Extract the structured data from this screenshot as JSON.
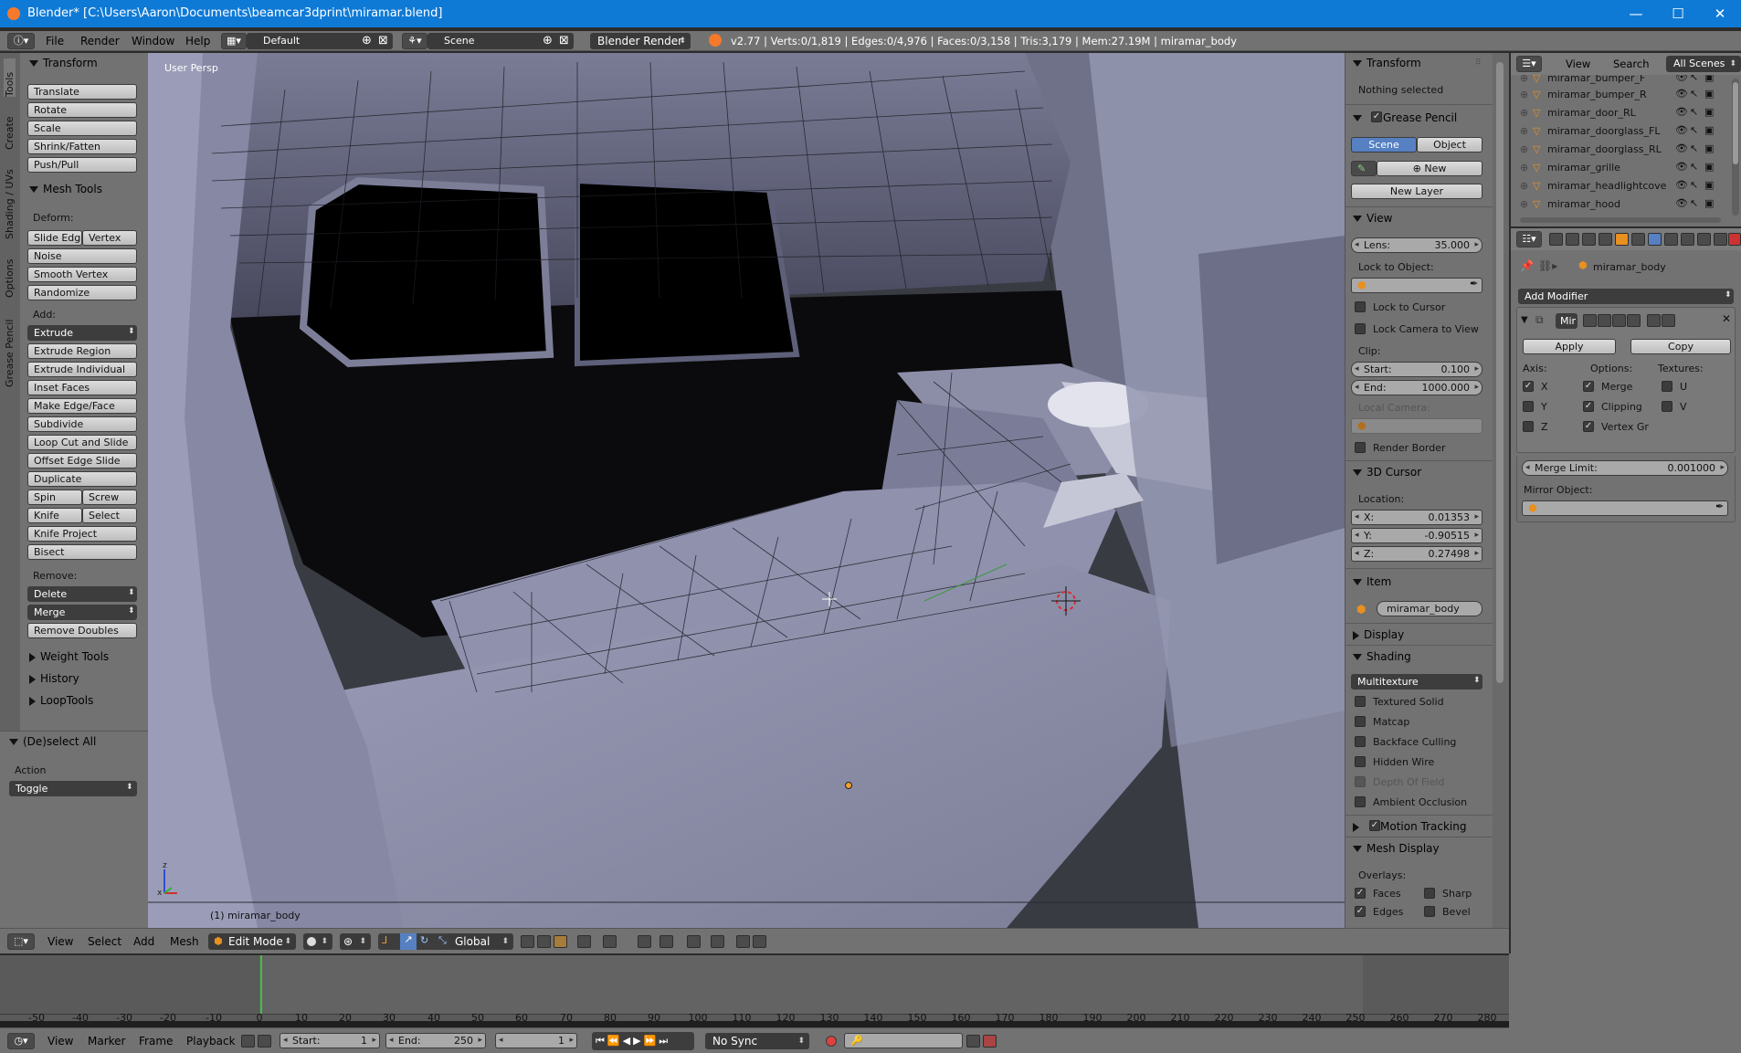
{
  "window": {
    "title": "Blender* [C:\\Users\\Aaron\\Documents\\beamcar3dprint\\miramar.blend]",
    "minimize": "—",
    "maximize": "☐",
    "close": "✕"
  },
  "menubar": {
    "info_icon": "info-icon",
    "items": [
      "File",
      "Render",
      "Window",
      "Help"
    ],
    "layout": "Default",
    "scene": "Scene",
    "engine": "Blender Render",
    "stats": "v2.77 | Verts:0/1,819 | Edges:0/4,976 | Faces:0/3,158 | Tris:3,179 | Mem:27.19M | miramar_body"
  },
  "toolshelf": {
    "tabs": [
      "Tools",
      "Create",
      "Shading / UVs",
      "Options",
      "Grease Pencil"
    ],
    "transform": {
      "title": "Transform",
      "buttons": [
        "Translate",
        "Rotate",
        "Scale",
        "Shrink/Fatten",
        "Push/Pull"
      ]
    },
    "mesh_tools": {
      "title": "Mesh Tools",
      "deform_label": "Deform:",
      "slide_edge": "Slide Edge",
      "vertex": "Vertex",
      "noise": "Noise",
      "smooth_vertex": "Smooth Vertex",
      "randomize": "Randomize",
      "add_label": "Add:",
      "extrude": "Extrude",
      "extrude_region": "Extrude Region",
      "extrude_individual": "Extrude Individual",
      "inset_faces": "Inset Faces",
      "make_edge_face": "Make Edge/Face",
      "subdivide": "Subdivide",
      "loop_cut": "Loop Cut and Slide",
      "offset_edge": "Offset Edge Slide",
      "duplicate": "Duplicate",
      "spin": "Spin",
      "screw": "Screw",
      "knife": "Knife",
      "select": "Select",
      "knife_project": "Knife Project",
      "bisect": "Bisect",
      "remove_label": "Remove:",
      "delete": "Delete",
      "merge": "Merge",
      "remove_doubles": "Remove Doubles"
    },
    "collapsed": [
      "Weight Tools",
      "History",
      "LoopTools"
    ],
    "operator": {
      "title": "(De)select All",
      "action_label": "Action",
      "action_value": "Toggle"
    }
  },
  "viewport": {
    "view_name": "User Persp",
    "object_label": "(1) miramar_body"
  },
  "npanel": {
    "transform_title": "Transform",
    "nothing_selected": "Nothing selected",
    "grease_title": "Grease Pencil",
    "scene_btn": "Scene",
    "object_btn": "Object",
    "new_btn": "New",
    "new_layer": "New Layer",
    "view_title": "View",
    "lens_label": "Lens:",
    "lens_value": "35.000",
    "lock_object": "Lock to Object:",
    "lock_cursor": "Lock to Cursor",
    "lock_camera": "Lock Camera to View",
    "clip_label": "Clip:",
    "clip_start_label": "Start:",
    "clip_start": "0.100",
    "clip_end_label": "End:",
    "clip_end": "1000.000",
    "local_camera": "Local Camera:",
    "render_border": "Render Border",
    "cursor_title": "3D Cursor",
    "location_label": "Location:",
    "x_label": "X:",
    "x": "0.01353",
    "y_label": "Y:",
    "y": "-0.90515",
    "z_label": "Z:",
    "z": "0.27498",
    "item_title": "Item",
    "item_name": "miramar_body",
    "display_title": "Display",
    "shading_title": "Shading",
    "shading_mode": "Multitexture",
    "shading_opts": [
      "Textured Solid",
      "Matcap",
      "Backface Culling",
      "Hidden Wire",
      "Depth Of Field",
      "Ambient Occlusion"
    ],
    "motion_title": "Motion Tracking",
    "mesh_display_title": "Mesh Display",
    "overlays_label": "Overlays:",
    "faces": "Faces",
    "sharp": "Sharp",
    "edges": "Edges",
    "bevel": "Bevel"
  },
  "outliner": {
    "view": "View",
    "search": "Search",
    "scope": "All Scenes",
    "items": [
      "miramar_bumper_F",
      "miramar_bumper_R",
      "miramar_door_RL",
      "miramar_doorglass_FL",
      "miramar_doorglass_RL",
      "miramar_grille",
      "miramar_headlightcove",
      "miramar_hood"
    ]
  },
  "properties": {
    "object_name": "miramar_body",
    "add_modifier": "Add Modifier",
    "modifier_name": "Mir",
    "apply": "Apply",
    "copy": "Copy",
    "axis_label": "Axis:",
    "options_label": "Options:",
    "textures_label": "Textures:",
    "x": "X",
    "y": "Y",
    "z": "Z",
    "merge": "Merge",
    "clipping": "Clipping",
    "vertex_gr": "Vertex Gr",
    "u": "U",
    "v": "V",
    "merge_limit_label": "Merge Limit:",
    "merge_limit": "0.001000",
    "mirror_object": "Mirror Object:"
  },
  "view3d_header": {
    "items": [
      "View",
      "Select",
      "Add",
      "Mesh"
    ],
    "mode": "Edit Mode",
    "orientation": "Global"
  },
  "timeline": {
    "ticks": [
      "-50",
      "-40",
      "-30",
      "-20",
      "-10",
      "0",
      "10",
      "20",
      "30",
      "40",
      "50",
      "60",
      "70",
      "80",
      "90",
      "100",
      "110",
      "120",
      "130",
      "140",
      "150",
      "160",
      "170",
      "180",
      "190",
      "200",
      "210",
      "220",
      "230",
      "240",
      "250",
      "260",
      "270",
      "280"
    ],
    "current_frame": "0"
  },
  "timeline_header": {
    "items": [
      "View",
      "Marker",
      "Frame",
      "Playback"
    ],
    "start_label": "Start:",
    "start": "1",
    "end_label": "End:",
    "end": "250",
    "frame": "1",
    "sync": "No Sync"
  },
  "colors": {
    "titlebar": "#0f7ad6",
    "panel": "#727272",
    "selected": "#5680c2",
    "record": "#e04040"
  }
}
